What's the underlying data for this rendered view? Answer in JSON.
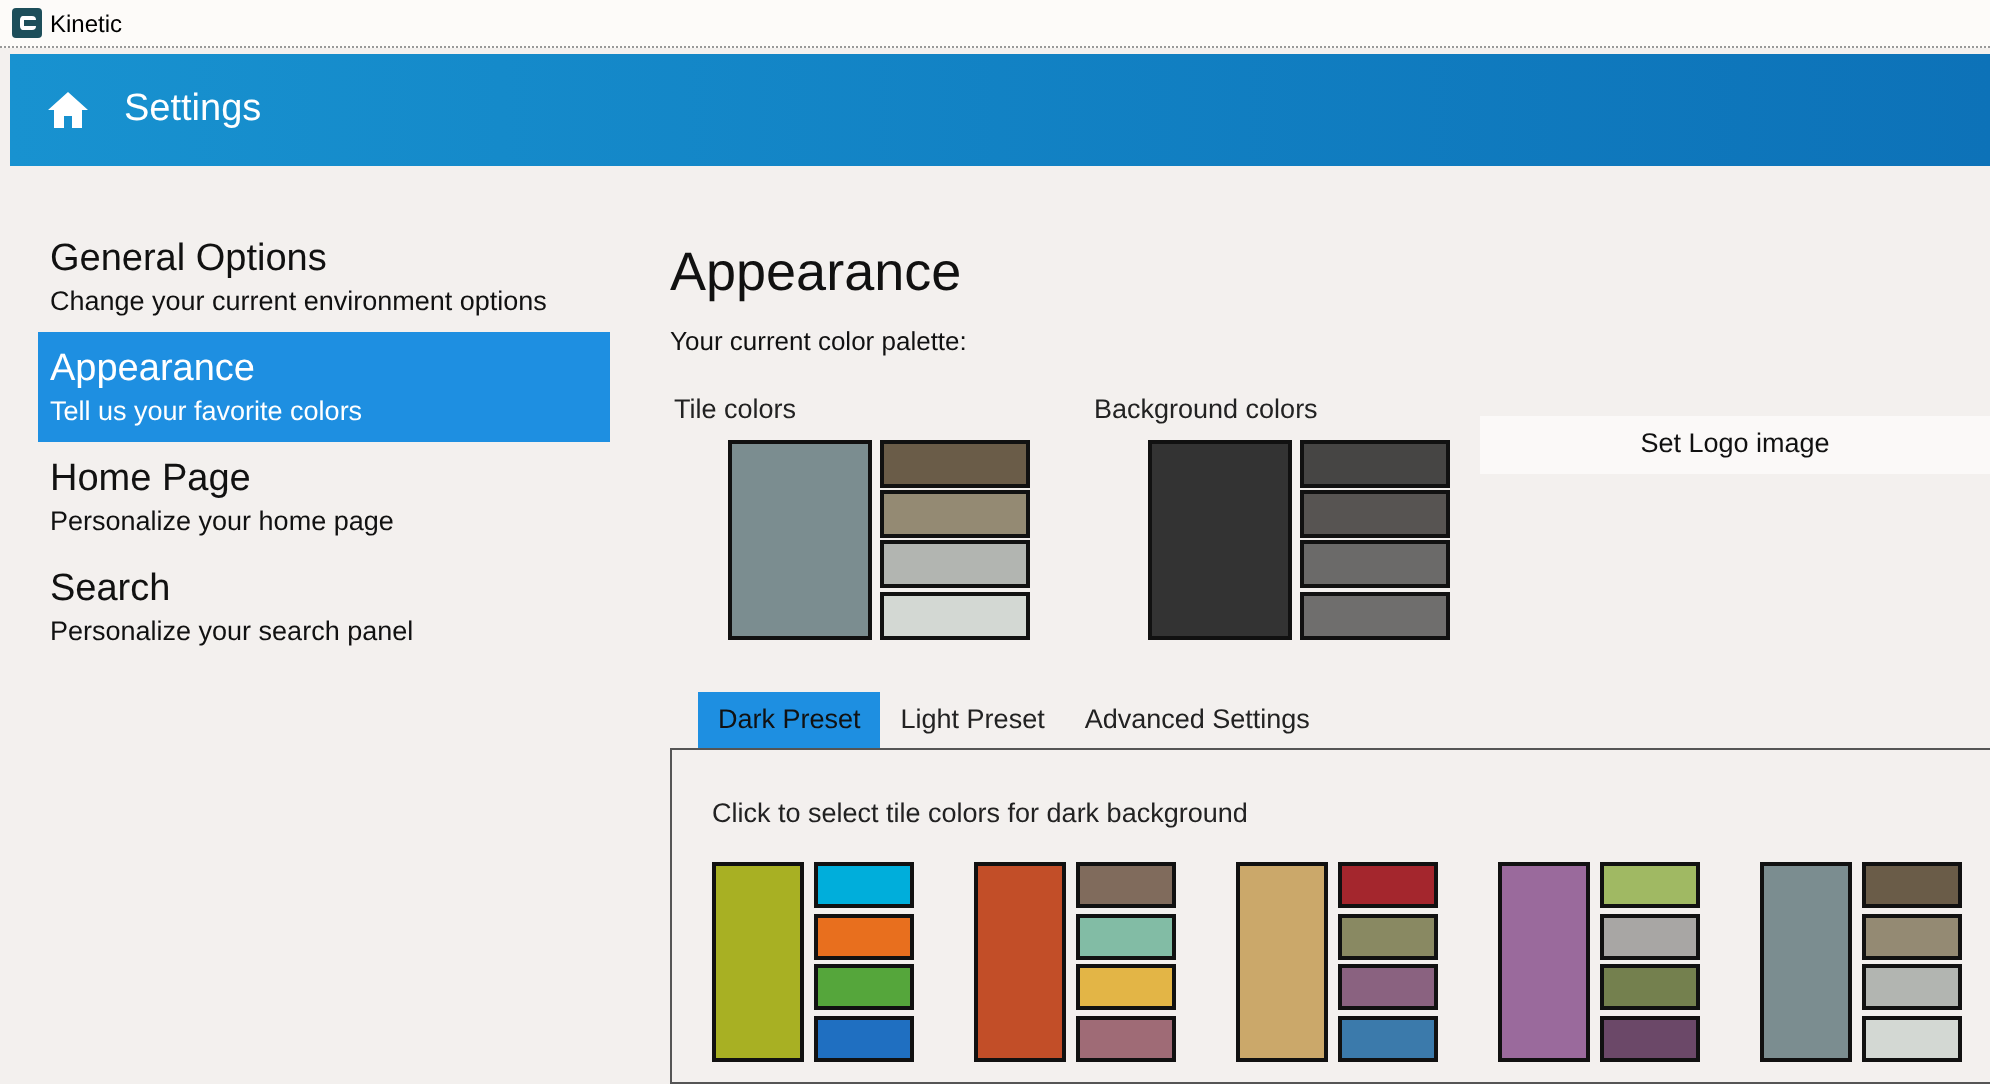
{
  "window": {
    "title": "Kinetic"
  },
  "header": {
    "title": "Settings"
  },
  "sidebar": {
    "items": [
      {
        "title": "General Options",
        "subtitle": "Change your current environment options",
        "selected": false
      },
      {
        "title": "Appearance",
        "subtitle": "Tell us your favorite colors",
        "selected": true
      },
      {
        "title": "Home Page",
        "subtitle": "Personalize your home page",
        "selected": false
      },
      {
        "title": "Search",
        "subtitle": "Personalize your search panel",
        "selected": false
      }
    ]
  },
  "content": {
    "title": "Appearance",
    "subtitle": "Your current color palette:",
    "current": [
      {
        "label": "Tile colors",
        "swatches": [
          {
            "color": "#7b8d90"
          },
          {
            "color": "#6a5c48"
          },
          {
            "color": "#948a73"
          },
          {
            "color": "#b2b5b1"
          },
          {
            "color": "#d3d8d3"
          }
        ]
      },
      {
        "label": "Background colors",
        "swatches": [
          {
            "color": "#333333"
          },
          {
            "color": "#464544"
          },
          {
            "color": "#575452"
          },
          {
            "color": "#6b6a69"
          },
          {
            "color": "#6f6e6d"
          }
        ]
      }
    ],
    "logo_button": "Set Logo image",
    "tabs": [
      {
        "label": "Dark Preset",
        "selected": true
      },
      {
        "label": "Light Preset",
        "selected": false
      },
      {
        "label": "Advanced Settings",
        "selected": false
      }
    ],
    "instruction": "Click to select tile colors for dark background",
    "presets": [
      {
        "swatches": [
          {
            "color": "#a8b023"
          },
          {
            "color": "#00aedb"
          },
          {
            "color": "#e86f1e"
          },
          {
            "color": "#55a63b"
          },
          {
            "color": "#1f6fc1"
          }
        ]
      },
      {
        "swatches": [
          {
            "color": "#c24e28"
          },
          {
            "color": "#806b5c"
          },
          {
            "color": "#82bca5"
          },
          {
            "color": "#e3b546"
          },
          {
            "color": "#9f6b76"
          }
        ]
      },
      {
        "swatches": [
          {
            "color": "#cba86a"
          },
          {
            "color": "#a4262d"
          },
          {
            "color": "#898962"
          },
          {
            "color": "#8a6280"
          },
          {
            "color": "#3b7aab"
          }
        ]
      },
      {
        "swatches": [
          {
            "color": "#9a6a9c"
          },
          {
            "color": "#a0b963"
          },
          {
            "color": "#a8a6a4"
          },
          {
            "color": "#74804e"
          },
          {
            "color": "#6b4868"
          }
        ]
      },
      {
        "swatches": [
          {
            "color": "#7b8d90"
          },
          {
            "color": "#6a5c48"
          },
          {
            "color": "#948a73"
          },
          {
            "color": "#b2b5b1"
          },
          {
            "color": "#d3d8d3"
          }
        ]
      }
    ]
  }
}
